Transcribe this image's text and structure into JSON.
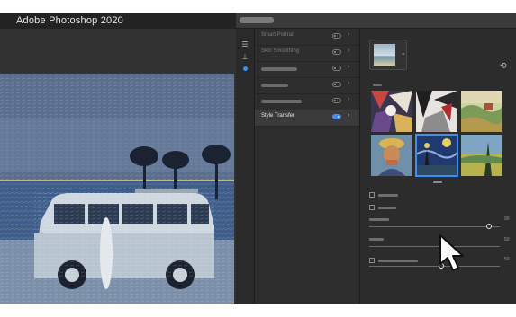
{
  "app": {
    "title": "Adobe Photoshop 2020"
  },
  "colors": {
    "accent": "#3f8cff",
    "panel": "#2b2b2b"
  },
  "tools": [
    {
      "icon": "sliders-icon"
    },
    {
      "icon": "brush-icon"
    },
    {
      "icon": "dot-indicator-icon"
    }
  ],
  "filters": [
    {
      "label": "Smart Portrait",
      "enabled": false
    },
    {
      "label": "Skin Smoothing",
      "enabled": false
    },
    {
      "label": "",
      "enabled": false
    },
    {
      "label": "",
      "enabled": false
    },
    {
      "label": "",
      "enabled": false
    },
    {
      "label": "Style Transfer",
      "enabled": true,
      "selected": true
    }
  ],
  "style_presets": [
    {
      "name": "cubist-painting",
      "selected": false
    },
    {
      "name": "abstract-black-white",
      "selected": false
    },
    {
      "name": "country-landscape",
      "selected": false
    },
    {
      "name": "van-gogh-self-portrait",
      "selected": false
    },
    {
      "name": "starry-night",
      "selected": true
    },
    {
      "name": "wheat-field-cypresses",
      "selected": false
    }
  ],
  "settings": {
    "sliders": [
      {
        "value": "90",
        "level": 0.92
      },
      {
        "value": "50",
        "level": 0.55
      },
      {
        "value": "50",
        "level": 0.55
      }
    ]
  }
}
